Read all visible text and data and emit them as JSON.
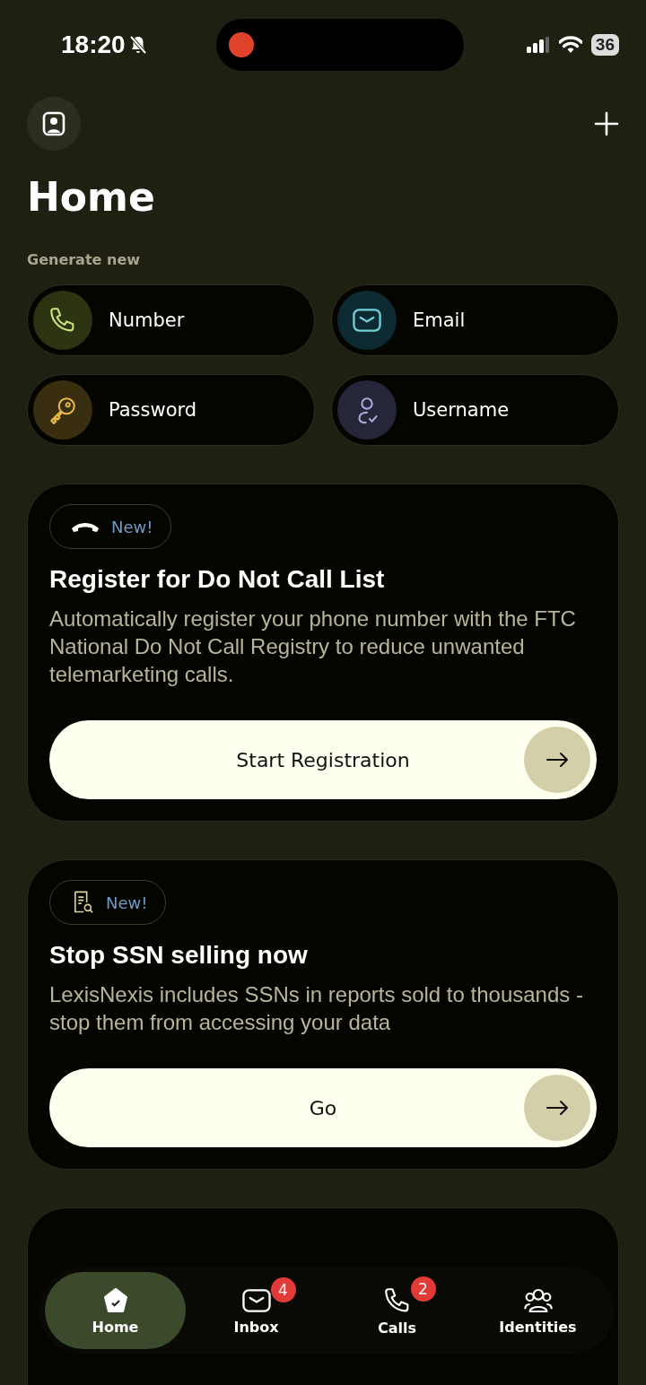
{
  "status_bar": {
    "time": "18:20",
    "muted": true,
    "recording": true,
    "battery": "36"
  },
  "header": {
    "title": "Home"
  },
  "generate": {
    "label": "Generate new",
    "items": [
      {
        "kind": "phone",
        "label": "Number"
      },
      {
        "kind": "email",
        "label": "Email"
      },
      {
        "kind": "key",
        "label": "Password"
      },
      {
        "kind": "user",
        "label": "Username"
      }
    ]
  },
  "cards": [
    {
      "kind": "phone",
      "badge": "New!",
      "title": "Register for Do Not Call List",
      "body": "Automatically register your phone number with the FTC National Do Not Call Registry to reduce unwanted telemarketing calls.",
      "button": "Start Registration"
    },
    {
      "kind": "document",
      "badge": "New!",
      "title": "Stop SSN selling now",
      "body": "LexisNexis includes SSNs in reports sold to thousands - stop them from accessing your data",
      "button": "Go"
    }
  ],
  "tab_bar": [
    {
      "kind": "home",
      "label": "Home",
      "selected": true
    },
    {
      "kind": "inbox",
      "label": "Inbox",
      "selected": false,
      "badge": "4"
    },
    {
      "kind": "calls",
      "label": "Calls",
      "selected": false,
      "badge": "2"
    },
    {
      "kind": "identities",
      "label": "Identities",
      "selected": false
    }
  ]
}
